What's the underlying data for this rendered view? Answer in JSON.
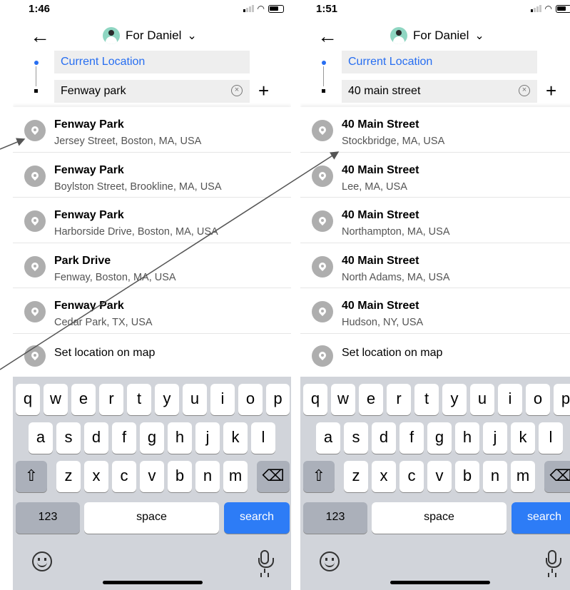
{
  "left": {
    "time": "1:46",
    "rider": "For Daniel",
    "pickup": "Current Location",
    "destination": "Fenway park",
    "results": [
      {
        "title": "Fenway Park",
        "sub": "Jersey Street, Boston, MA, USA"
      },
      {
        "title": "Fenway Park",
        "sub": "Boylston Street, Brookline, MA, USA"
      },
      {
        "title": "Fenway Park",
        "sub": "Harborside Drive, Boston, MA, USA"
      },
      {
        "title": "Park Drive",
        "sub": "Fenway, Boston, MA, USA"
      },
      {
        "title": "Fenway Park",
        "sub": "Cedar Park, TX, USA"
      }
    ],
    "set_on_map": "Set location on map"
  },
  "right": {
    "time": "1:51",
    "rider": "For Daniel",
    "pickup": "Current Location",
    "destination": "40 main street",
    "results": [
      {
        "title": "40 Main Street",
        "sub": "Stockbridge, MA, USA"
      },
      {
        "title": "40 Main Street",
        "sub": "Lee, MA, USA"
      },
      {
        "title": "40 Main Street",
        "sub": "Northampton, MA, USA"
      },
      {
        "title": "40 Main Street",
        "sub": "North Adams, MA, USA"
      },
      {
        "title": "40 Main Street",
        "sub": "Hudson, NY, USA"
      }
    ],
    "set_on_map": "Set location on map"
  },
  "keyboard": {
    "row1": [
      "q",
      "w",
      "e",
      "r",
      "t",
      "y",
      "u",
      "i",
      "o",
      "p"
    ],
    "row2": [
      "a",
      "s",
      "d",
      "f",
      "g",
      "h",
      "j",
      "k",
      "l"
    ],
    "row3": [
      "z",
      "x",
      "c",
      "v",
      "b",
      "n",
      "m"
    ],
    "shift": "⇧",
    "backspace": "⌫",
    "numbers": "123",
    "space": "space",
    "search": "search"
  },
  "icons": {
    "back": "arrow-left-icon",
    "pin": "location-pin-icon",
    "clear": "clear-circle-icon",
    "plus": "add-stop-icon",
    "emoji": "emoji-icon",
    "mic": "microphone-icon"
  },
  "colors": {
    "accent": "#276ef1",
    "search_key": "#2d7cf6",
    "keyboard_bg": "#d1d4da",
    "pin_gray": "#aeaeae"
  }
}
